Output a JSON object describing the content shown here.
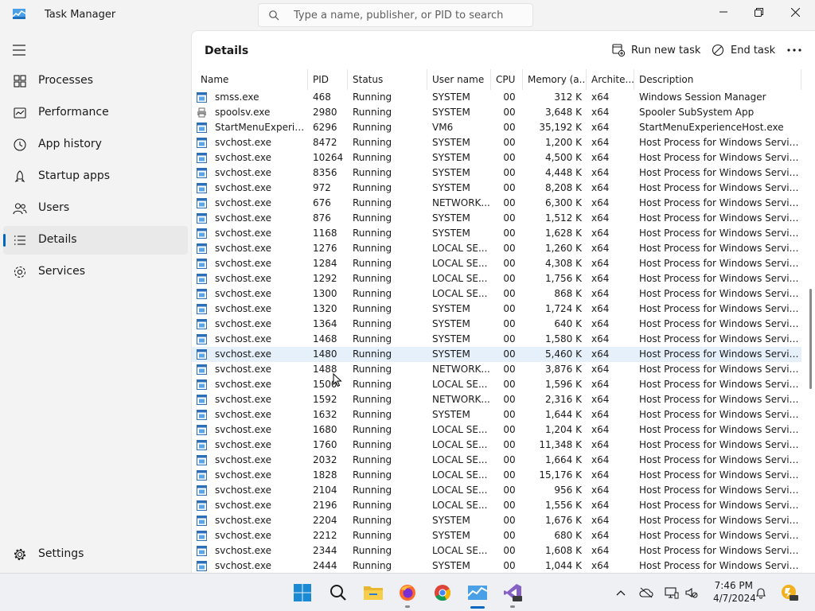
{
  "window": {
    "title": "Task Manager"
  },
  "search": {
    "placeholder": "Type a name, publisher, or PID to search"
  },
  "sidebar": {
    "items": [
      {
        "label": "Processes",
        "icon": "processes-icon"
      },
      {
        "label": "Performance",
        "icon": "performance-icon"
      },
      {
        "label": "App history",
        "icon": "app-history-icon"
      },
      {
        "label": "Startup apps",
        "icon": "startup-apps-icon"
      },
      {
        "label": "Users",
        "icon": "users-icon"
      },
      {
        "label": "Details",
        "icon": "details-icon",
        "active": true
      },
      {
        "label": "Services",
        "icon": "services-icon"
      }
    ],
    "settings_label": "Settings"
  },
  "details": {
    "title": "Details",
    "run_new_task_label": "Run new task",
    "end_task_label": "End task",
    "columns": [
      "Name",
      "PID",
      "Status",
      "User name",
      "CPU",
      "Memory (a...",
      "Archite...",
      "Description"
    ],
    "rows": [
      [
        "smss.exe",
        "468",
        "Running",
        "SYSTEM",
        "00",
        "312 K",
        "x64",
        "Windows Session Manager"
      ],
      [
        "spoolsv.exe",
        "2980",
        "Running",
        "SYSTEM",
        "00",
        "3,648 K",
        "x64",
        "Spooler SubSystem App"
      ],
      [
        "StartMenuExperienc...",
        "6296",
        "Running",
        "VM6",
        "00",
        "35,192 K",
        "x64",
        "StartMenuExperienceHost.exe"
      ],
      [
        "svchost.exe",
        "8472",
        "Running",
        "SYSTEM",
        "00",
        "1,200 K",
        "x64",
        "Host Process for Windows Services"
      ],
      [
        "svchost.exe",
        "10264",
        "Running",
        "SYSTEM",
        "00",
        "4,500 K",
        "x64",
        "Host Process for Windows Services"
      ],
      [
        "svchost.exe",
        "8356",
        "Running",
        "SYSTEM",
        "00",
        "4,448 K",
        "x64",
        "Host Process for Windows Services"
      ],
      [
        "svchost.exe",
        "972",
        "Running",
        "SYSTEM",
        "00",
        "8,208 K",
        "x64",
        "Host Process for Windows Services"
      ],
      [
        "svchost.exe",
        "676",
        "Running",
        "NETWORK...",
        "00",
        "6,300 K",
        "x64",
        "Host Process for Windows Services"
      ],
      [
        "svchost.exe",
        "876",
        "Running",
        "SYSTEM",
        "00",
        "1,512 K",
        "x64",
        "Host Process for Windows Services"
      ],
      [
        "svchost.exe",
        "1168",
        "Running",
        "SYSTEM",
        "00",
        "1,628 K",
        "x64",
        "Host Process for Windows Services"
      ],
      [
        "svchost.exe",
        "1276",
        "Running",
        "LOCAL SE...",
        "00",
        "1,260 K",
        "x64",
        "Host Process for Windows Services"
      ],
      [
        "svchost.exe",
        "1284",
        "Running",
        "LOCAL SE...",
        "00",
        "4,308 K",
        "x64",
        "Host Process for Windows Services"
      ],
      [
        "svchost.exe",
        "1292",
        "Running",
        "LOCAL SE...",
        "00",
        "1,756 K",
        "x64",
        "Host Process for Windows Services"
      ],
      [
        "svchost.exe",
        "1300",
        "Running",
        "LOCAL SE...",
        "00",
        "868 K",
        "x64",
        "Host Process for Windows Services"
      ],
      [
        "svchost.exe",
        "1320",
        "Running",
        "SYSTEM",
        "00",
        "1,724 K",
        "x64",
        "Host Process for Windows Services"
      ],
      [
        "svchost.exe",
        "1364",
        "Running",
        "SYSTEM",
        "00",
        "640 K",
        "x64",
        "Host Process for Windows Services"
      ],
      [
        "svchost.exe",
        "1468",
        "Running",
        "SYSTEM",
        "00",
        "1,580 K",
        "x64",
        "Host Process for Windows Services"
      ],
      [
        "svchost.exe",
        "1480",
        "Running",
        "SYSTEM",
        "00",
        "5,460 K",
        "x64",
        "Host Process for Windows Services"
      ],
      [
        "svchost.exe",
        "1488",
        "Running",
        "NETWORK...",
        "00",
        "3,876 K",
        "x64",
        "Host Process for Windows Services"
      ],
      [
        "svchost.exe",
        "1500",
        "Running",
        "LOCAL SE...",
        "00",
        "1,596 K",
        "x64",
        "Host Process for Windows Services"
      ],
      [
        "svchost.exe",
        "1592",
        "Running",
        "NETWORK...",
        "00",
        "2,316 K",
        "x64",
        "Host Process for Windows Services"
      ],
      [
        "svchost.exe",
        "1632",
        "Running",
        "SYSTEM",
        "00",
        "1,644 K",
        "x64",
        "Host Process for Windows Services"
      ],
      [
        "svchost.exe",
        "1680",
        "Running",
        "LOCAL SE...",
        "00",
        "1,204 K",
        "x64",
        "Host Process for Windows Services"
      ],
      [
        "svchost.exe",
        "1760",
        "Running",
        "LOCAL SE...",
        "00",
        "11,348 K",
        "x64",
        "Host Process for Windows Services"
      ],
      [
        "svchost.exe",
        "2032",
        "Running",
        "LOCAL SE...",
        "00",
        "1,664 K",
        "x64",
        "Host Process for Windows Services"
      ],
      [
        "svchost.exe",
        "1828",
        "Running",
        "LOCAL SE...",
        "00",
        "15,176 K",
        "x64",
        "Host Process for Windows Services"
      ],
      [
        "svchost.exe",
        "2104",
        "Running",
        "LOCAL SE...",
        "00",
        "956 K",
        "x64",
        "Host Process for Windows Services"
      ],
      [
        "svchost.exe",
        "2196",
        "Running",
        "LOCAL SE...",
        "00",
        "1,556 K",
        "x64",
        "Host Process for Windows Services"
      ],
      [
        "svchost.exe",
        "2204",
        "Running",
        "SYSTEM",
        "00",
        "1,676 K",
        "x64",
        "Host Process for Windows Services"
      ],
      [
        "svchost.exe",
        "2212",
        "Running",
        "SYSTEM",
        "00",
        "680 K",
        "x64",
        "Host Process for Windows Services"
      ],
      [
        "svchost.exe",
        "2344",
        "Running",
        "LOCAL SE...",
        "00",
        "1,608 K",
        "x64",
        "Host Process for Windows Services"
      ],
      [
        "svchost.exe",
        "2444",
        "Running",
        "SYSTEM",
        "00",
        "1,044 K",
        "x64",
        "Host Process for Windows Services"
      ]
    ],
    "selected_row": 17
  },
  "taskbar": {
    "apps": [
      "start-icon",
      "search-icon",
      "file-explorer-icon",
      "firefox-icon",
      "chrome-icon",
      "task-manager-icon",
      "visual-studio-preview-icon"
    ],
    "clock_time": "7:46 PM",
    "clock_date": "4/7/2024"
  },
  "colors": {
    "accent": "#0067c0",
    "selected_row": "#e5f0fb",
    "background": "#f3f3f3"
  }
}
